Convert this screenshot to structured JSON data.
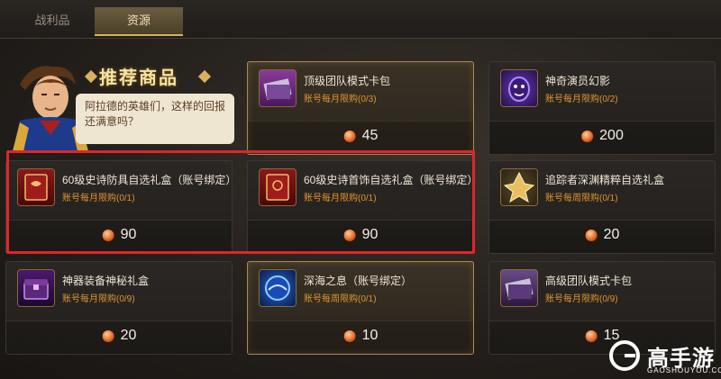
{
  "tabs": [
    {
      "label": "战利品"
    },
    {
      "label": "资源"
    }
  ],
  "recommend": {
    "title": "推荐商品",
    "speech": "阿拉德的英雄们，这样的回报还满意吗？"
  },
  "items": [
    {
      "name": "顶级团队模式卡包",
      "limit": "账号每月限购(0/3)",
      "price": "45",
      "highlight": true,
      "icon": "card-pack-icon"
    },
    {
      "name": "神奇演员幻影",
      "limit": "账号每月限购(0/2)",
      "price": "200",
      "highlight": false,
      "icon": "phantom-mask-icon"
    },
    {
      "name": "60级史诗防具自选礼盒（账号绑定）",
      "limit": "账号每月限购(0/1)",
      "price": "90",
      "highlight": false,
      "icon": "red-book-icon"
    },
    {
      "name": "60级史诗首饰自选礼盒（账号绑定）",
      "limit": "账号每月限购(0/1)",
      "price": "90",
      "highlight": false,
      "icon": "red-book-icon"
    },
    {
      "name": "追踪者深渊精粹自选礼盒",
      "limit": "账号每周限购(0/1)",
      "price": "20",
      "highlight": false,
      "icon": "gold-crystal-icon"
    },
    {
      "name": "神器装备神秘礼盒",
      "limit": "账号每月限购(0/9)",
      "price": "20",
      "highlight": false,
      "icon": "purple-chest-icon"
    },
    {
      "name": "深海之息（账号绑定）",
      "limit": "账号每周限购(0/1)",
      "price": "10",
      "highlight": true,
      "icon": "blue-orb-icon"
    },
    {
      "name": "高级团队模式卡包",
      "limit": "账号每月限购(0/9)",
      "price": "15",
      "highlight": false,
      "icon": "card-pack-icon"
    }
  ],
  "logo": {
    "text": "高手游",
    "sub": "GAOSHOUYOU.COM"
  },
  "colors": {
    "accent": "#d9b25e",
    "limit": "#e0962e",
    "highlight_box": "#e0252b"
  }
}
